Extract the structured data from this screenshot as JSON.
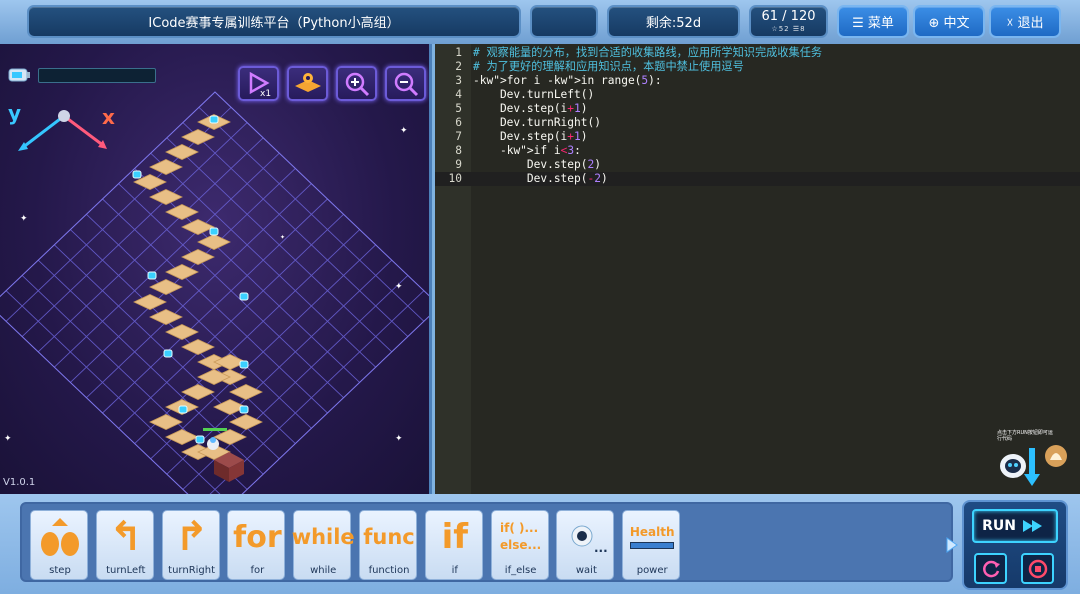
{
  "header": {
    "title": "ICode赛事专属训练平台（Python小高组）",
    "blank_pill": "",
    "remaining": "剩余:52d",
    "level_main": "61 / 120",
    "level_sub": "☆52  ☰8",
    "menu_label": "☰ 菜单",
    "lang_label": "⊕ 中文",
    "exit_label": "☓ 退出"
  },
  "game": {
    "version": "V1.0.1",
    "axis_y": "y",
    "axis_x": "x",
    "tools": [
      "play-speed-icon",
      "map-icon",
      "zoom-in-icon",
      "zoom-out-icon"
    ]
  },
  "editor": {
    "active_line": 10,
    "lines": [
      {
        "n": "1",
        "text": "# 观察能量的分布，找到合适的收集路线，应用所学知识完成收集任务"
      },
      {
        "n": "2",
        "text": "# 为了更好的理解和应用知识点，本题中禁止使用逗号"
      },
      {
        "n": "3",
        "text": "for i in range(5):"
      },
      {
        "n": "4",
        "text": "    Dev.turnLeft()"
      },
      {
        "n": "5",
        "text": "    Dev.step(i+1)"
      },
      {
        "n": "6",
        "text": "    Dev.turnRight()"
      },
      {
        "n": "7",
        "text": "    Dev.step(i+1)"
      },
      {
        "n": "8",
        "text": "    if i<3:"
      },
      {
        "n": "9",
        "text": "        Dev.step(2)"
      },
      {
        "n": "10",
        "text": "        Dev.step(-2)"
      }
    ]
  },
  "helper": {
    "hint": "点击下方RUN按钮即可运行代码"
  },
  "palette": {
    "blocks": [
      {
        "label": "step",
        "glyph": ""
      },
      {
        "label": "turnLeft",
        "glyph": "↰"
      },
      {
        "label": "turnRight",
        "glyph": "↱"
      },
      {
        "label": "for",
        "glyph": "for"
      },
      {
        "label": "while",
        "glyph": "while"
      },
      {
        "label": "function",
        "glyph": "func"
      },
      {
        "label": "if",
        "glyph": "if"
      },
      {
        "label": "if_else",
        "glyph": "if( )...\nelse..."
      },
      {
        "label": "wait",
        "glyph": ""
      },
      {
        "label": "power",
        "glyph": "Health"
      }
    ]
  },
  "run": {
    "run_label": "RUN"
  },
  "colors": {
    "accent": "#3dd3ff",
    "block_orange": "#f39a2a",
    "editor_bg": "#272822"
  }
}
